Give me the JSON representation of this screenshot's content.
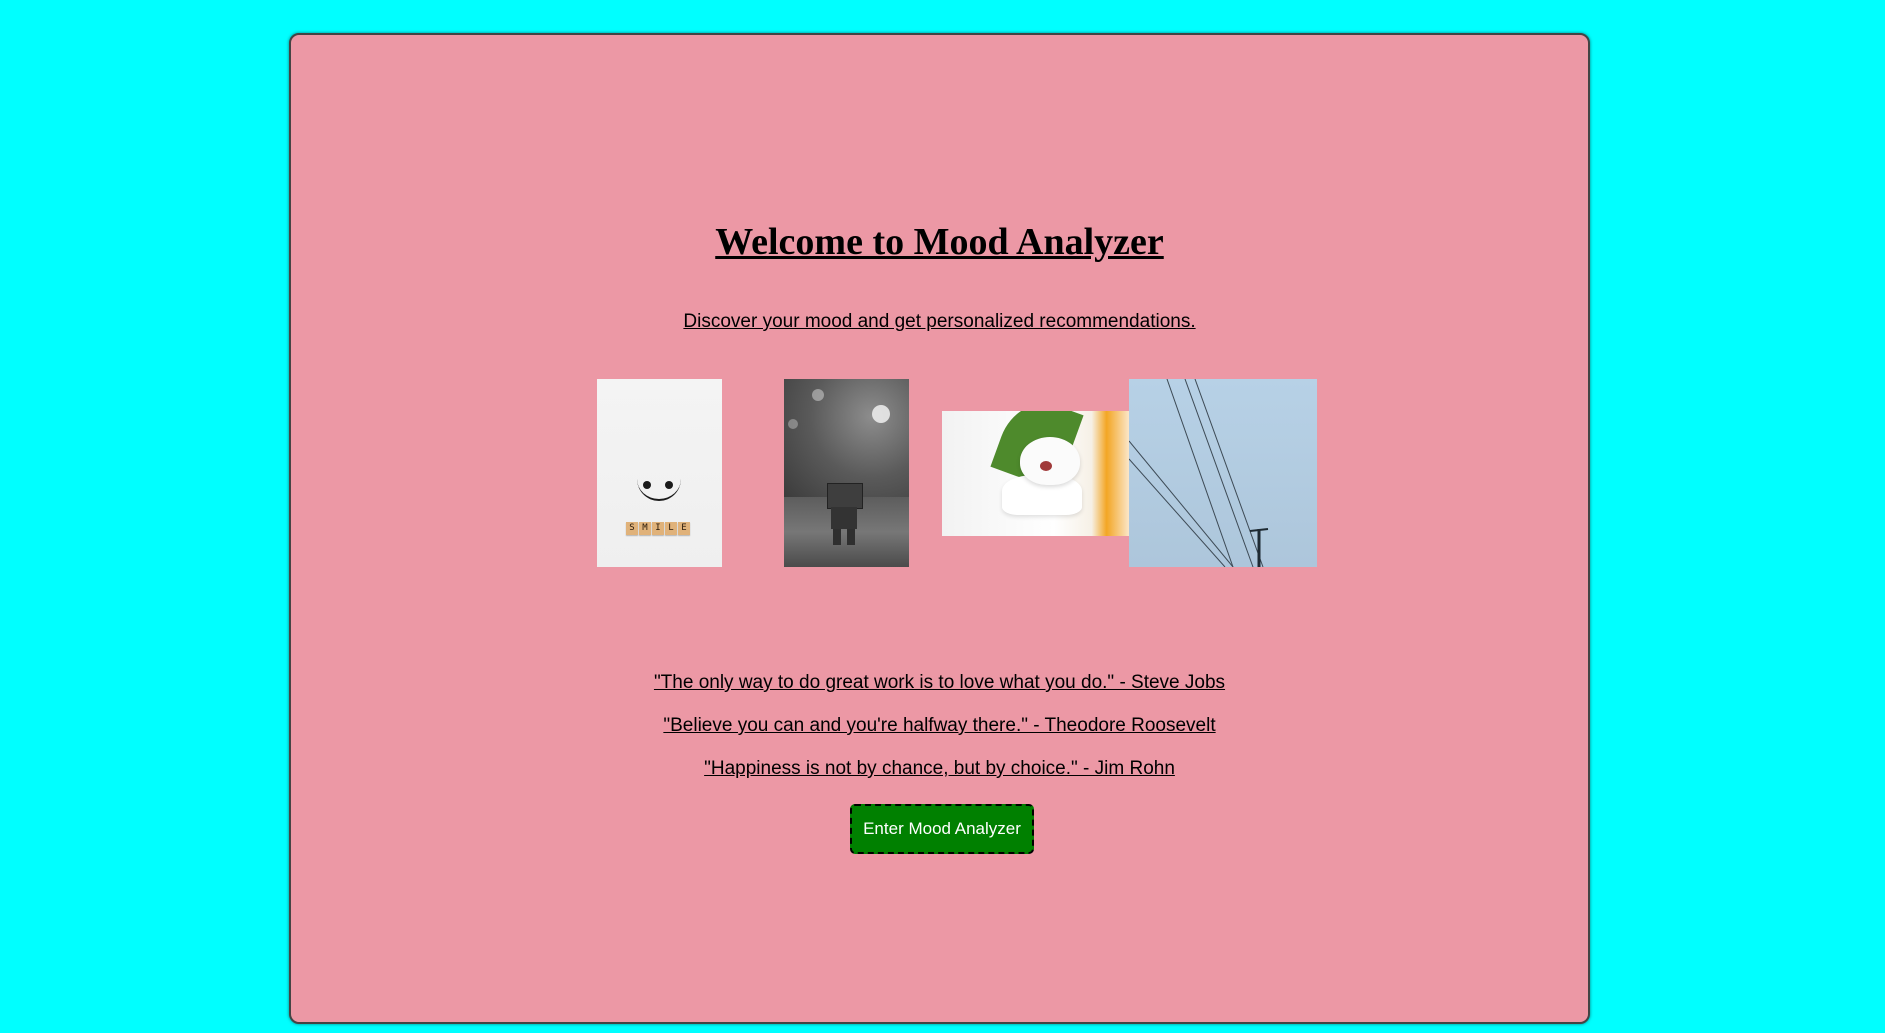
{
  "page": {
    "background_color": "#00ffff",
    "card_color": "#ec98a5",
    "title": "Welcome to Mood Analyzer",
    "subtitle": "Discover your mood and get personalized recommendations."
  },
  "images": [
    {
      "name": "smile-image",
      "alt": "Smile",
      "tiles": [
        "S",
        "M",
        "I",
        "L",
        "E"
      ]
    },
    {
      "name": "robot-figure-image",
      "alt": ""
    },
    {
      "name": "cat-image",
      "alt": ""
    },
    {
      "name": "sky-power-lines-image",
      "alt": ""
    }
  ],
  "quotes": [
    "\"The only way to do great work is to love what you do.\" - Steve Jobs",
    "\"Believe you can and you're halfway there.\" - Theodore Roosevelt",
    "\"Happiness is not by chance, but by choice.\" - Jim Rohn"
  ],
  "button": {
    "label": "Enter Mood Analyzer",
    "color": "#008000"
  }
}
